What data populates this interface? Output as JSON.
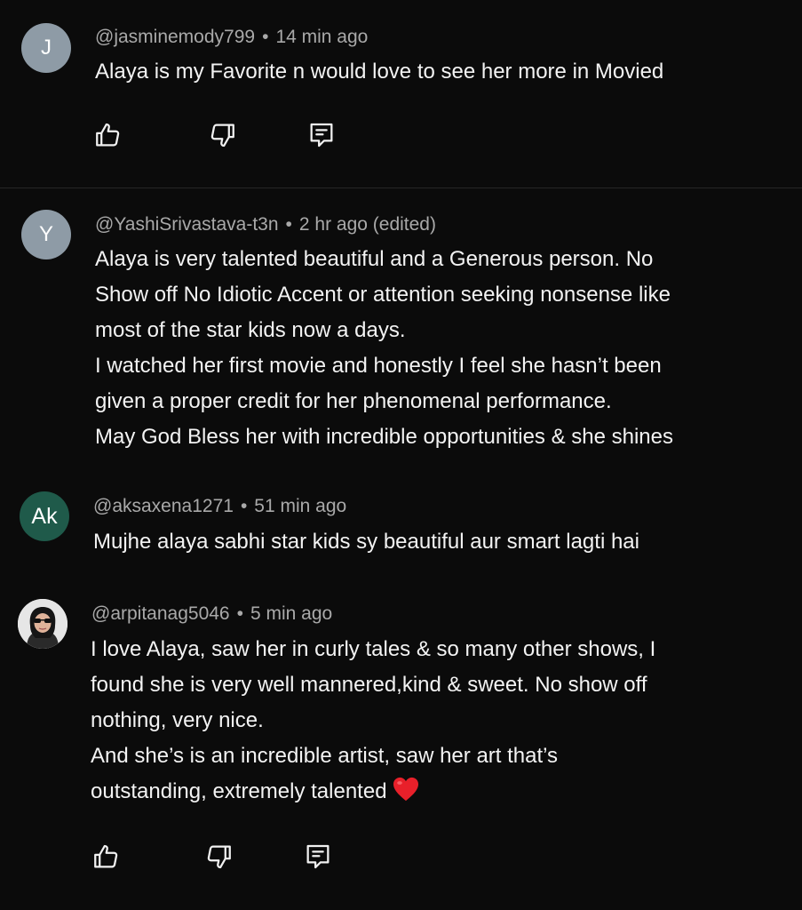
{
  "comments": [
    {
      "avatar_letter": "J",
      "avatar_color": "#8e9ba6",
      "handle": "@jasminemody799",
      "time": "14 min ago",
      "lines": [
        "Alaya is my Favorite n would love to see her more in Movied"
      ]
    },
    {
      "avatar_letter": "Y",
      "avatar_color": "#8e9ba6",
      "handle": "@YashiSrivastava-t3n",
      "time": "2 hr ago (edited)",
      "lines": [
        "Alaya is very talented beautiful and a Generous person. No",
        "Show off No Idiotic Accent or attention seeking nonsense like",
        "most of the star kids now a days.",
        "I watched her first movie and honestly I feel she hasn’t been",
        "given a proper credit for her phenomenal performance.",
        "May God Bless her with incredible opportunities & she shines"
      ]
    },
    {
      "avatar_letter": "Ak",
      "avatar_color": "#1f5a4a",
      "handle": "@aksaxena1271",
      "time": "51 min ago",
      "lines": [
        "Mujhe alaya sabhi star kids sy beautiful aur smart lagti hai"
      ]
    },
    {
      "avatar_letter": "",
      "avatar_color": "#e9e9e9",
      "handle": "@arpitanag5046",
      "time": "5 min ago",
      "lines": [
        "I love Alaya, saw her in curly tales & so many other shows, I",
        "found she is very well mannered,kind & sweet. No show off",
        "nothing, very nice.",
        "And she’s is an incredible artist, saw her art that’s",
        "outstanding, extremely talented"
      ]
    }
  ],
  "separator": "•",
  "icons": {
    "like": "thumbs-up-icon",
    "dislike": "thumbs-down-icon",
    "reply": "reply-icon",
    "heart": "red-heart-emoji"
  },
  "colors": {
    "background": "#0b0b0b",
    "text": "#f3f3f3",
    "meta": "#a9a9a9",
    "heart": "#e8202a"
  }
}
